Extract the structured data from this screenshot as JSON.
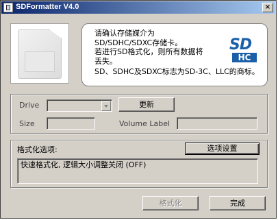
{
  "window": {
    "title": "SDFormatter V4.0",
    "close_glyph": "×"
  },
  "info": {
    "para1": "请确认存储媒介为\nSD/SDHC/SDXC存储卡。\n若进行SD格式化，则所有数据将\n丢失。",
    "para2": "SD、SDHC及SDXC标志为SD-3C、LLC的商标。"
  },
  "logo": {
    "top": "SD",
    "bottom": "HC"
  },
  "drive": {
    "label": "Drive",
    "value": ""
  },
  "refresh_button": "更新",
  "size": {
    "label": "Size",
    "value": ""
  },
  "volume": {
    "label": "Volume Label",
    "value": ""
  },
  "format_options": {
    "label": "格式化选项:",
    "settings_button": "选项设置",
    "summary": "快速格式化, 逻辑大小调整关闭 (OFF)"
  },
  "footer": {
    "format_button": "格式化",
    "finish_button": "完成"
  }
}
